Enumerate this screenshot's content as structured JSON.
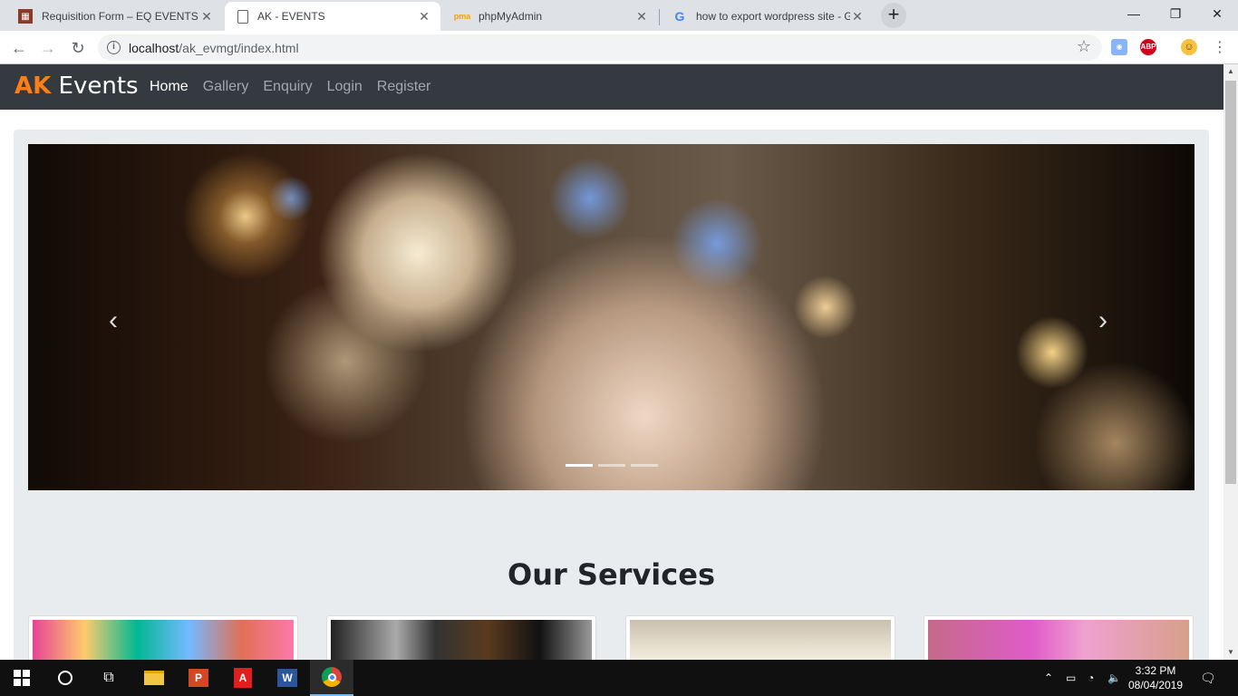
{
  "browser": {
    "tabs": [
      {
        "label": "Requisition Form – EQ EVENTS",
        "active": false
      },
      {
        "label": "AK - EVENTS",
        "active": true
      },
      {
        "label": "phpMyAdmin",
        "active": false
      },
      {
        "label": "how to export wordpress site - G",
        "active": false
      }
    ],
    "new_tab": "+",
    "url_host": "localhost",
    "url_path": "/ak_evmgt/index.html",
    "window_controls": {
      "minimize": "—",
      "restore": "❐",
      "close": "✕"
    }
  },
  "site": {
    "brand_accent": "AK",
    "brand_rest": " Events",
    "nav": [
      {
        "label": "Home",
        "active": true
      },
      {
        "label": "Gallery",
        "active": false
      },
      {
        "label": "Enquiry",
        "active": false
      },
      {
        "label": "Login",
        "active": false
      },
      {
        "label": "Register",
        "active": false
      }
    ],
    "carousel": {
      "prev": "‹",
      "next": "›",
      "slides": 3,
      "active_slide": 1
    },
    "services_title": "Our Services",
    "service_cards": [
      "party-decor-image",
      "flyer-image",
      "banquet-hall-image",
      "stage-lights-image"
    ]
  },
  "taskbar": {
    "time": "3:32 PM",
    "date": "08/04/2019"
  },
  "colors": {
    "brand_orange": "#fd7e14",
    "nav_dark": "#343a40",
    "jumbotron": "#e9ecef"
  }
}
